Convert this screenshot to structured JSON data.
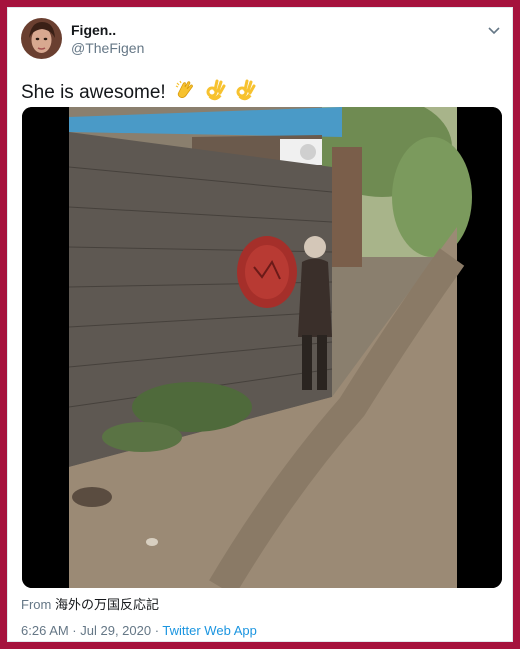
{
  "user": {
    "name": "Figen..",
    "handle": "@TheFigen"
  },
  "tweet": {
    "text": "She is awesome!",
    "emojis": [
      "clapping-hands",
      "ok-hand",
      "ok-hand"
    ]
  },
  "source": {
    "label": "From",
    "value": "海外の万国反応記"
  },
  "meta": {
    "timestamp": "6:26 AM · Jul 29, 2020 · ",
    "app": "Twitter Web App"
  },
  "colors": {
    "frame": "#a5123d",
    "link": "#1b95e0",
    "muted": "#657786"
  }
}
